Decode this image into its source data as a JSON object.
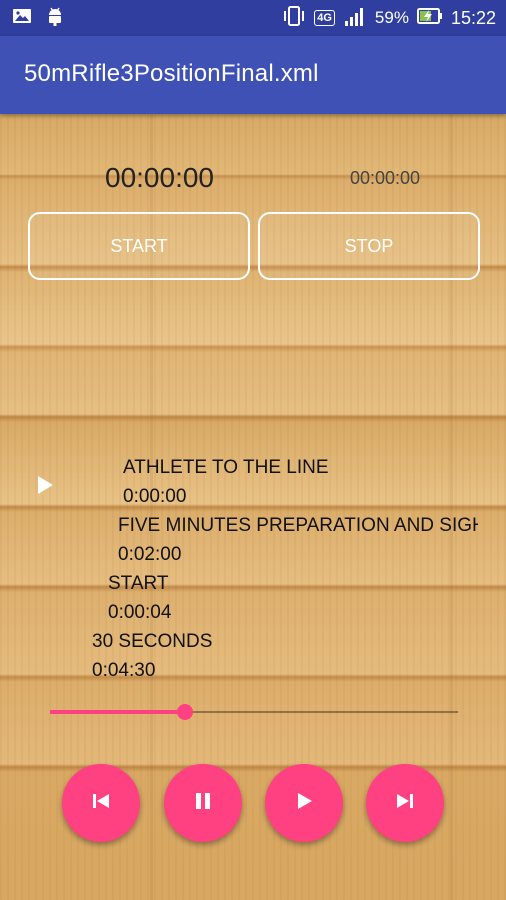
{
  "status_bar": {
    "network": "4G",
    "battery": "59%",
    "time": "15:22"
  },
  "app_bar": {
    "title": "50mRifle3PositionFinal.xml"
  },
  "timers": {
    "main": "00:00:00",
    "secondary": "00:00:00"
  },
  "controls": {
    "start_label": "START",
    "stop_label": "STOP"
  },
  "events": [
    {
      "label": "ATHLETE TO THE LINE",
      "time": "0:00:00"
    },
    {
      "label": "FIVE MINUTES PREPARATION AND SIGHTING",
      "time": "0:02:00"
    },
    {
      "label": "START",
      "time": "0:00:04"
    },
    {
      "label": "30 SECONDS",
      "time": "0:04:30"
    }
  ],
  "player": {
    "progress_fraction": 0.33,
    "buttons": [
      "previous",
      "pause",
      "play",
      "next"
    ]
  },
  "colors": {
    "status_bar": "#303F9F",
    "app_bar": "#3F51B5",
    "accent": "#FF4081"
  }
}
